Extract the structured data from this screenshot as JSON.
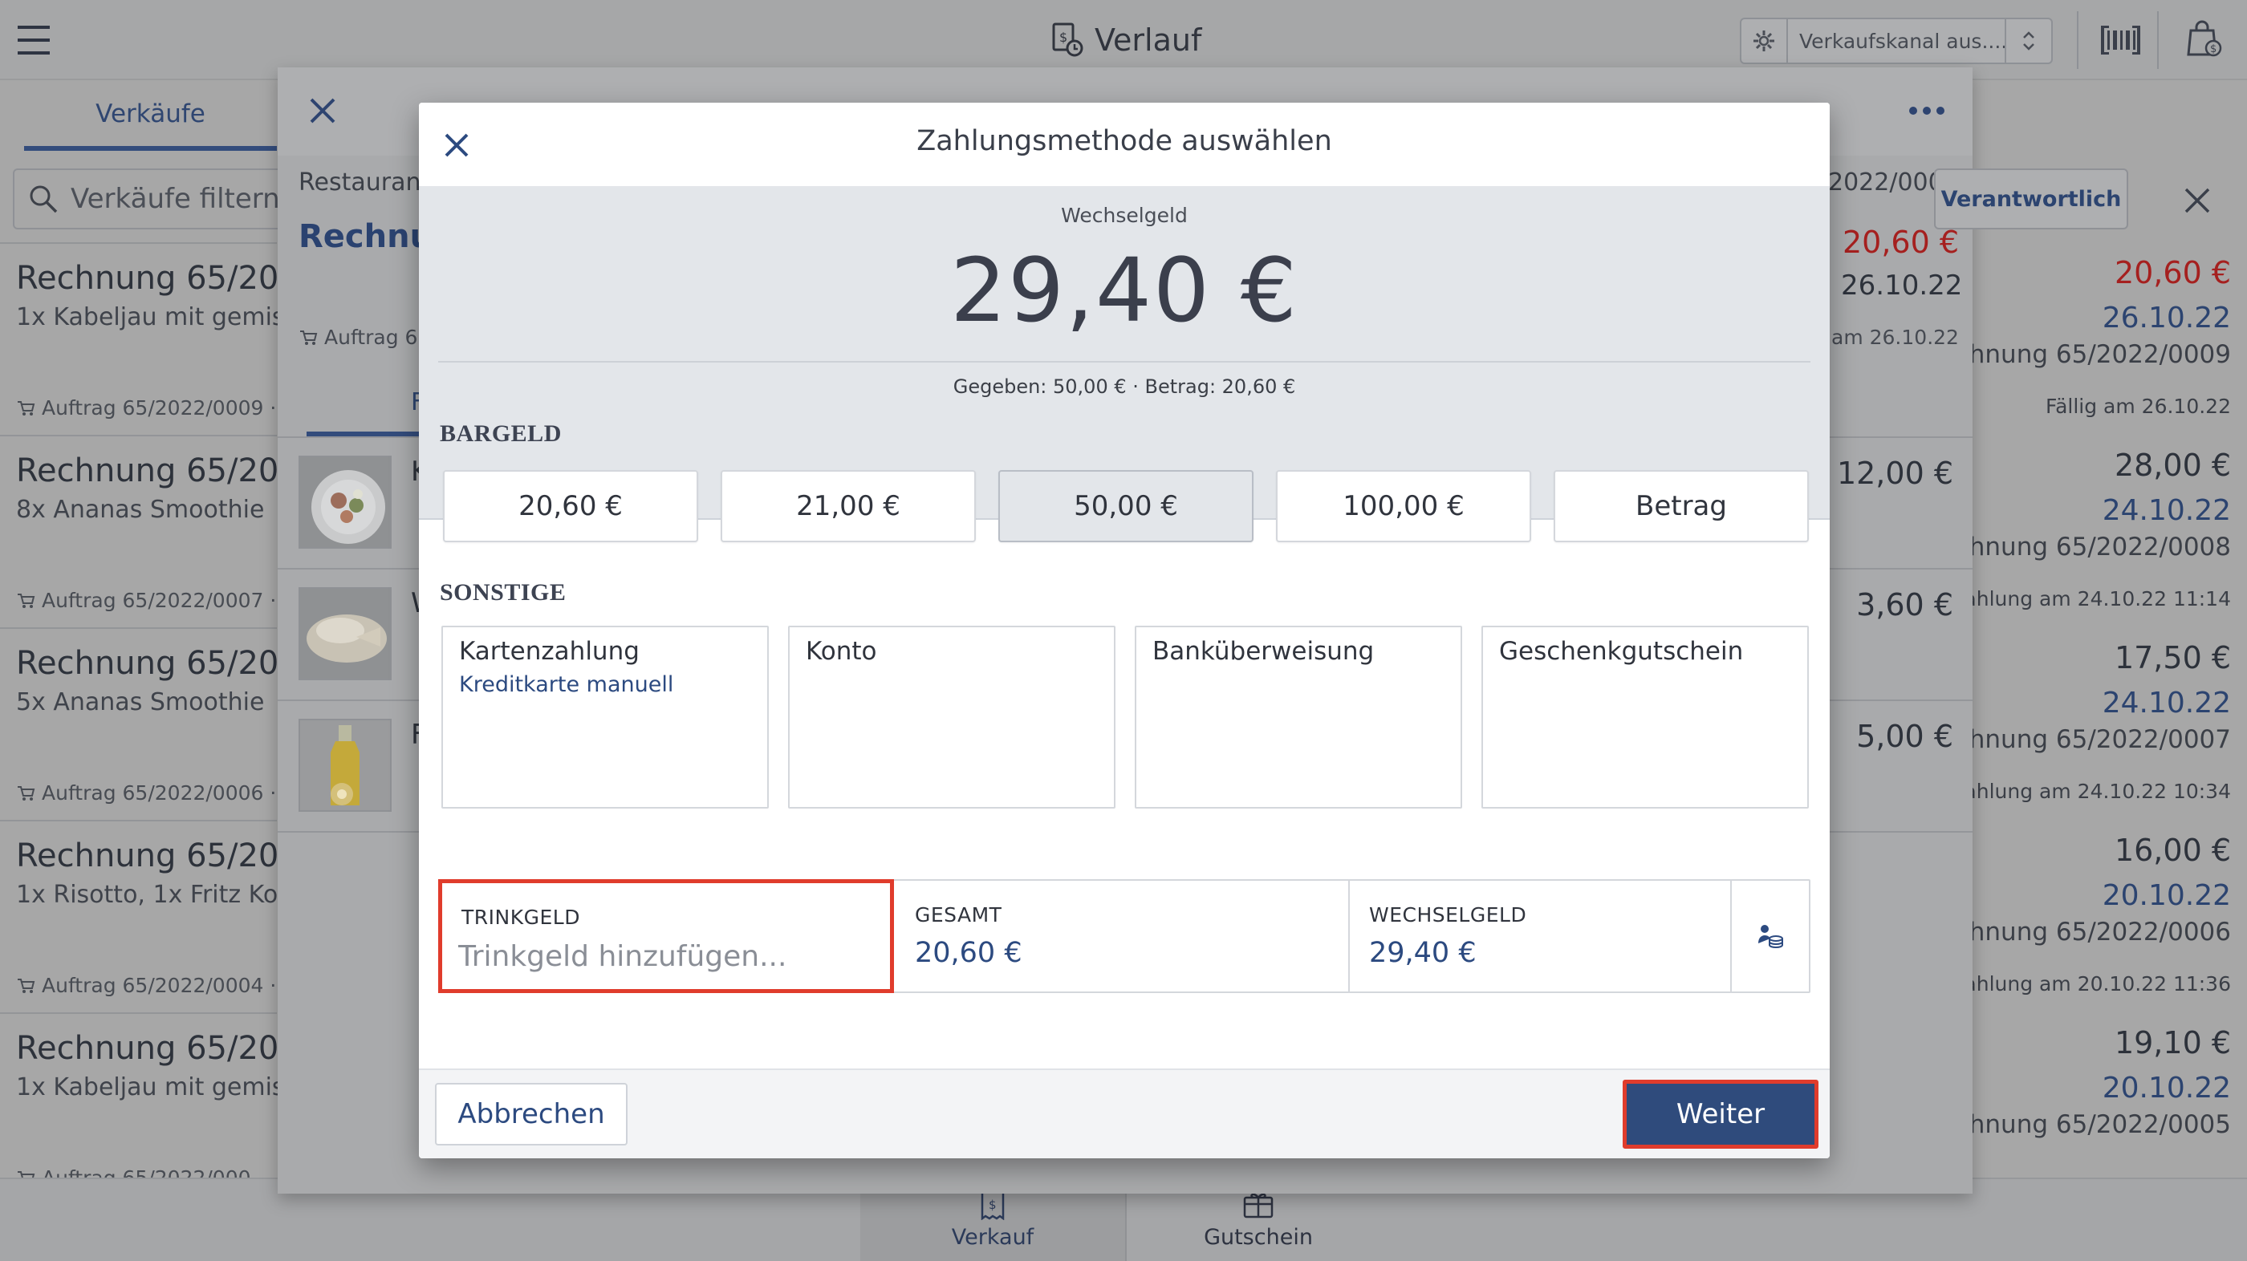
{
  "topbar": {
    "title": "Verlauf",
    "channel_placeholder": "Verkaufskanal aus......"
  },
  "list": {
    "tab_label": "Verkäufe",
    "filter_placeholder": "Verkäufe filtern ...",
    "rows": [
      {
        "title": "Rechnung 65/2022",
        "items": "1x Kabeljau mit gemischt",
        "order": "Auftrag 65/2022/0009 ·",
        "amount": "20,60 €",
        "date": "26.10.22",
        "ref": "Rechnung 65/2022/0009",
        "paid": "Fällig am 26.10.22",
        "amount_color": "#a5201f"
      },
      {
        "title": "Rechnung 65/2022",
        "items": "8x Ananas Smoothie",
        "order": "Auftrag 65/2022/0007 ·",
        "amount": "28,00 €",
        "date": "24.10.22",
        "ref": "Rechnung 65/2022/0008",
        "paid": "Barzahlung am 24.10.22 11:14",
        "amount_color": "#2d323b"
      },
      {
        "title": "Rechnung 65/2022",
        "items": "5x Ananas Smoothie",
        "order": "Auftrag 65/2022/0006 ·",
        "amount": "17,50 €",
        "date": "24.10.22",
        "ref": "Rechnung 65/2022/0007",
        "paid": "Barzahlung am 24.10.22 10:34",
        "amount_color": "#2d323b"
      },
      {
        "title": "Rechnung 65/2022",
        "items": "1x Risotto, 1x Fritz Kola",
        "order": "Auftrag 65/2022/0004 ·",
        "amount": "16,00 €",
        "date": "20.10.22",
        "ref": "Rechnung 65/2022/0006",
        "paid": "Barzahlung am 20.10.22 11:36",
        "amount_color": "#2d323b"
      },
      {
        "title": "Rechnung 65/2022",
        "items": "1x Kabeljau mit gemischt",
        "order": "Auftrag 65/2022/000",
        "amount": "19,10 €",
        "date": "20.10.22",
        "ref": "Rechnung 65/2022/0005",
        "paid": "",
        "amount_color": "#2d323b"
      }
    ]
  },
  "sheet": {
    "meta": "Restaurant",
    "title": "Rechnun",
    "order": "Auftrag 65",
    "tab": "F",
    "right_no": "2022/0009",
    "right_amount": "20,60 €",
    "right_date": "26.10.22",
    "right_due": "am 26.10.22",
    "responsible": "Verantwortlich",
    "items": [
      {
        "name": "K",
        "price": "12,00 €"
      },
      {
        "name": "W",
        "price": "3,60 €"
      },
      {
        "name": "F",
        "price": "5,00 €"
      }
    ]
  },
  "dialog": {
    "title": "Zahlungsmethode auswählen",
    "change_label": "Wechselgeld",
    "change_amount": "29,40 €",
    "change_detail": "Gegeben: 50,00 € · Betrag: 20,60 €",
    "cash_section": "BARGELD",
    "cash_options": [
      "20,60 €",
      "21,00 €",
      "50,00 €",
      "100,00 €",
      "Betrag"
    ],
    "cash_selected_index": 2,
    "other_section": "SONSTIGE",
    "methods": [
      {
        "title": "Kartenzahlung",
        "subtitle": "Kreditkarte manuell"
      },
      {
        "title": "Konto",
        "subtitle": ""
      },
      {
        "title": "Banküberweisung",
        "subtitle": ""
      },
      {
        "title": "Geschenkgutschein",
        "subtitle": ""
      }
    ],
    "tip_label": "TRINKGELD",
    "tip_placeholder": "Trinkgeld hinzufügen...",
    "total_label": "GESAMT",
    "total_value": "20,60 €",
    "change_field_label": "WECHSELGELD",
    "change_field_value": "29,40 €",
    "cancel_label": "Abbrechen",
    "next_label": "Weiter"
  },
  "bottom_nav": {
    "verkauf": "Verkauf",
    "gutschein": "Gutschein"
  },
  "colors": {
    "accent": "#2f4b7c",
    "highlight": "#e03c2c",
    "overdue": "#a5201f"
  }
}
